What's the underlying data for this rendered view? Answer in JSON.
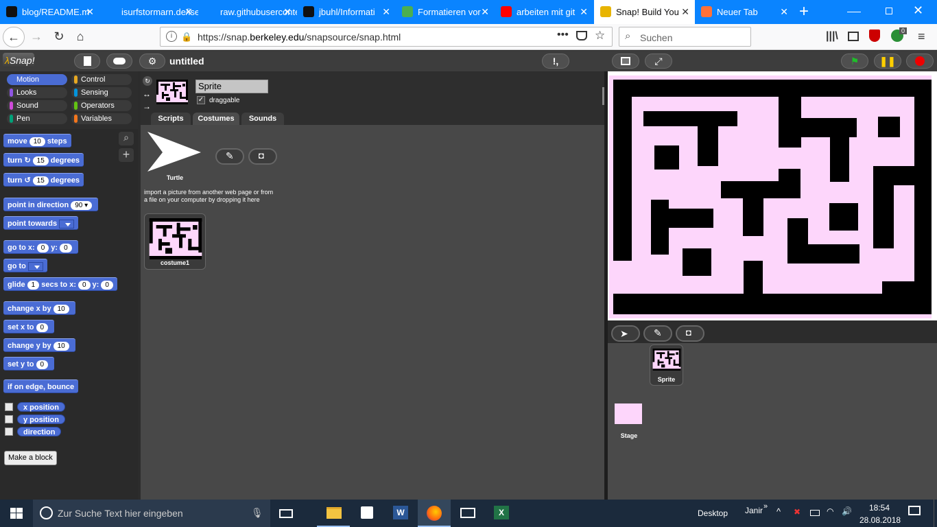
{
  "browser": {
    "tabs": [
      {
        "title": "blog/README.m",
        "icon": "github-icon",
        "color": "#111111"
      },
      {
        "title": "isurfstormarn.de/ise",
        "icon": "page-icon",
        "color": "#0a84ff"
      },
      {
        "title": "raw.githubuserconte",
        "icon": "page-icon",
        "color": "#0a84ff"
      },
      {
        "title": "jbuhl/Informati",
        "icon": "github-icon",
        "color": "#111111"
      },
      {
        "title": "Formatieren vor",
        "icon": "tool-icon",
        "color": "#4caf50"
      },
      {
        "title": "arbeiten mit git",
        "icon": "youtube-icon",
        "color": "#ff0000"
      },
      {
        "title": "Snap! Build You",
        "icon": "snap-lambda-icon",
        "color": "#e8b400"
      },
      {
        "title": "Neuer Tab",
        "icon": "firefox-icon",
        "color": "#ff7139"
      }
    ],
    "url": "https://snap.berkeley.edu/snapsource/snap.html",
    "url_plain_1": "https://snap.",
    "url_host": "berkeley.edu",
    "url_plain_2": "/snapsource/snap.html",
    "search_placeholder": "Suchen",
    "badge_count": "0"
  },
  "snap": {
    "project_name": "untitled",
    "categories": [
      {
        "label": "Motion",
        "color": "#4a6cd4"
      },
      {
        "label": "Control",
        "color": "#e6a822"
      },
      {
        "label": "Looks",
        "color": "#8f56e3"
      },
      {
        "label": "Sensing",
        "color": "#0494dc"
      },
      {
        "label": "Sound",
        "color": "#cf4ad9"
      },
      {
        "label": "Operators",
        "color": "#62c213"
      },
      {
        "label": "Pen",
        "color": "#00a178"
      },
      {
        "label": "Variables",
        "color": "#f3761d"
      }
    ],
    "blocks": {
      "move": "move",
      "move_val": "10",
      "steps": "steps",
      "turn": "turn",
      "turn_val": "15",
      "degrees": "degrees",
      "turn2_val": "15",
      "point_dir": "point in direction",
      "point_dir_val": "90",
      "point_towards": "point towards",
      "goto_xy": "go to x:",
      "y_label": "y:",
      "goto_x": "0",
      "goto_y": "0",
      "goto": "go to",
      "glide": "glide",
      "glide_secs": "1",
      "secs_to": "secs to x:",
      "glide_x": "0",
      "glide_y": "0",
      "change_x": "change x by",
      "change_x_val": "10",
      "set_x": "set x to",
      "set_x_val": "0",
      "change_y": "change y by",
      "change_y_val": "10",
      "set_y": "set y to",
      "set_y_val": "0",
      "bounce": "if on edge, bounce",
      "x_pos": "x position",
      "y_pos": "y position",
      "direction": "direction",
      "make_block": "Make a block"
    },
    "sprite": {
      "name": "Sprite",
      "draggable_label": "draggable",
      "draggable": true,
      "tabs": [
        "Scripts",
        "Costumes",
        "Sounds"
      ],
      "selected_tab": "Costumes",
      "turtle_label": "Turtle",
      "import_hint_1": "import a picture from another web page or from",
      "import_hint_2": "a file on your computer by dropping it here",
      "costume_name": "costume1"
    },
    "corral": {
      "sprite_label": "Sprite",
      "stage_label": "Stage"
    }
  },
  "taskbar": {
    "search_placeholder": "Zur Suche Text hier eingeben",
    "desktop_label": "Desktop",
    "user_label": "Janir",
    "time": "18:54",
    "date": "28.08.2018"
  }
}
